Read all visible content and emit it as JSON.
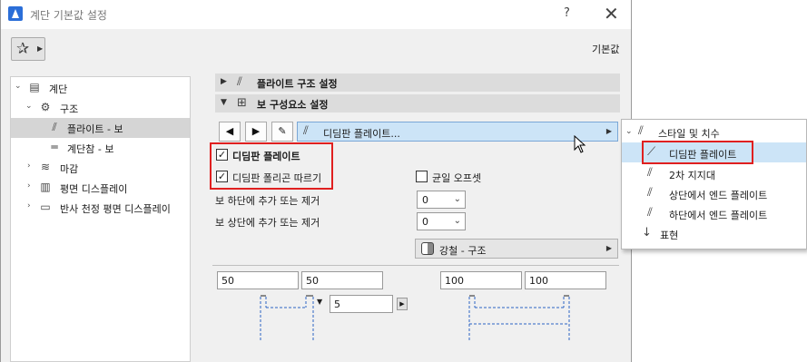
{
  "window": {
    "title": "계단 기본값 설정",
    "help": "?",
    "close": "✕"
  },
  "toolbar": {
    "default_label": "기본값"
  },
  "tree": [
    {
      "label": "계단",
      "expander": "⌄"
    },
    {
      "label": "구조",
      "expander": "⌄"
    },
    {
      "label": "플라이트 - 보",
      "expander": ""
    },
    {
      "label": "계단참 - 보",
      "expander": ""
    },
    {
      "label": "마감",
      "expander": "›"
    },
    {
      "label": "평면 디스플레이",
      "expander": "›"
    },
    {
      "label": "반사 천정 평면 디스플레이",
      "expander": "›"
    }
  ],
  "sections": {
    "flight": "플라이트 구조 설정",
    "components": "보 구성요소 설정"
  },
  "nav": {
    "prev": "◀",
    "next": "▶",
    "edit": "✎"
  },
  "member_select": {
    "label": "디딤판 플레이트..."
  },
  "checkboxes": {
    "tread_plate": {
      "label": "디딤판 플레이트",
      "checked": "✓"
    },
    "follow_polygon": {
      "label": "디딤판 폴리곤 따르기",
      "checked": "✓"
    },
    "uniform_offset": {
      "label": "균일 오프셋",
      "checked": ""
    }
  },
  "options": {
    "bottom": {
      "label": "보 하단에 추가 또는 제거",
      "value": "0"
    },
    "top": {
      "label": "보 상단에 추가 또는 제거",
      "value": "0"
    }
  },
  "material": {
    "label": "강철 - 구조"
  },
  "dims": {
    "left_a": "50",
    "left_b": "50",
    "step": "5",
    "right_a": "100",
    "right_b": "100"
  },
  "popup": {
    "header": "스타일 및 치수",
    "items": [
      "디딤판 플레이트",
      "2차 지지대",
      "상단에서 엔드 플레이트",
      "하단에서 엔드 플레이트"
    ],
    "footer": "표현"
  },
  "colors": {
    "highlight": "#cce4f7",
    "red_outline": "#e02020"
  }
}
